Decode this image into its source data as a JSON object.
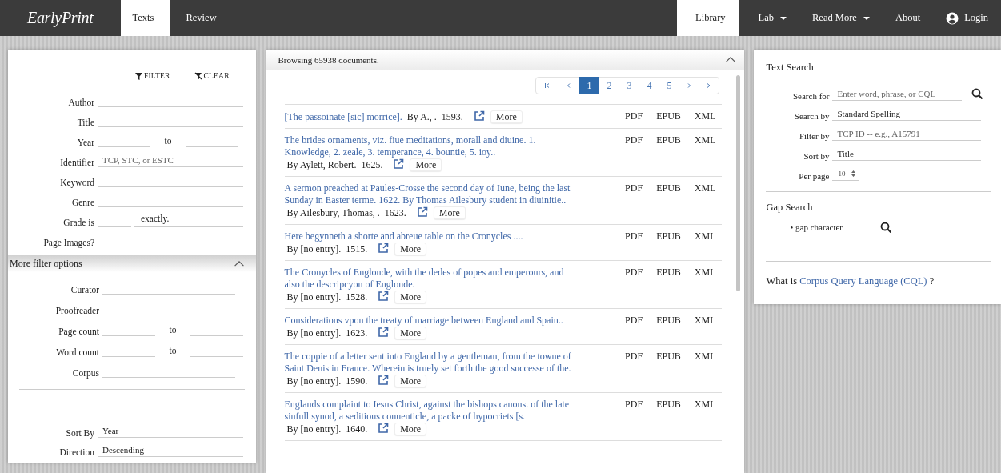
{
  "navbar": {
    "brand": "EarlyPrint",
    "left_tabs": [
      {
        "label": "Texts",
        "selected": true
      },
      {
        "label": "Review",
        "selected": false
      }
    ],
    "right_items": [
      {
        "label": "Library",
        "selected": true,
        "kind": "link"
      },
      {
        "label": "Lab",
        "selected": false,
        "kind": "dropdown"
      },
      {
        "label": "Read More",
        "selected": false,
        "kind": "dropdown"
      },
      {
        "label": "About",
        "selected": false,
        "kind": "link"
      },
      {
        "label": "Login",
        "selected": false,
        "kind": "user"
      }
    ]
  },
  "filter_panel": {
    "filter_button": "FILTER",
    "clear_button": "CLEAR",
    "fields": [
      {
        "label": "Author",
        "kind": "single"
      },
      {
        "label": "Title",
        "kind": "single"
      },
      {
        "label": "Year",
        "kind": "range",
        "between": "to"
      },
      {
        "label": "Identifier",
        "kind": "single",
        "placeholder": "TCP, STC, or ESTC"
      },
      {
        "label": "Keyword",
        "kind": "single"
      },
      {
        "label": "Genre",
        "kind": "single"
      },
      {
        "label": "Grade is",
        "kind": "grade",
        "suffix": "exactly."
      },
      {
        "label": "Page Images?",
        "kind": "short"
      }
    ],
    "more_options": {
      "title": "More filter options",
      "expanded": true,
      "fields": [
        {
          "label": "Curator",
          "kind": "single"
        },
        {
          "label": "Proofreader",
          "kind": "single"
        },
        {
          "label": "Page count",
          "kind": "range",
          "between": "to"
        },
        {
          "label": "Word count",
          "kind": "range",
          "between": "to"
        },
        {
          "label": "Corpus",
          "kind": "single"
        }
      ]
    },
    "sort_fields": [
      {
        "label": "Sort By",
        "value": "Year"
      },
      {
        "label": "Direction",
        "value": "Descending"
      }
    ]
  },
  "results": {
    "heading": "Browsing 65938 documents.",
    "expanded": true,
    "pages": [
      {
        "label": "1",
        "selected": true
      },
      {
        "label": "2",
        "selected": false
      },
      {
        "label": "3",
        "selected": false
      },
      {
        "label": "4",
        "selected": false
      },
      {
        "label": "5",
        "selected": false
      }
    ],
    "rows": [
      {
        "title": "[The passoinate [sic] morrice].",
        "byline": "By A., .",
        "year": "1593.",
        "more": "More",
        "formats": [
          "PDF",
          "EPUB",
          "XML"
        ]
      },
      {
        "title": "The brides ornaments, viz. fiue meditations, morall and diuine. 1. Knowledge, 2. zeale, 3. temperance, 4. bountie, 5. ioy..",
        "byline": "By Aylett, Robert.",
        "year": "1625.",
        "more": "More",
        "formats": [
          "PDF",
          "EPUB",
          "XML"
        ]
      },
      {
        "title": "A sermon preached at Paules-Crosse the second day of Iune, being the last Sunday in Easter terme. 1622. By Thomas Ailesbury student in diuinitie..",
        "byline": "By Ailesbury, Thomas, .",
        "year": "1623.",
        "more": "More",
        "formats": [
          "PDF",
          "EPUB",
          "XML"
        ]
      },
      {
        "title": "Here begynneth a shorte and abreue table on the Cronycles ....",
        "byline": "By [no entry].",
        "year": "1515.",
        "more": "More",
        "formats": [
          "PDF",
          "EPUB",
          "XML"
        ]
      },
      {
        "title": "The Cronycles of Englonde, with the dedes of popes and emperours, and also the descripcyon of Englonde.",
        "byline": "By [no entry].",
        "year": "1528.",
        "more": "More",
        "formats": [
          "PDF",
          "EPUB",
          "XML"
        ]
      },
      {
        "title": "Considerations vpon the treaty of marriage between England and Spain..",
        "byline": "By [no entry].",
        "year": "1623.",
        "more": "More",
        "formats": [
          "PDF",
          "EPUB",
          "XML"
        ]
      },
      {
        "title": "The coppie of a letter sent into England by a gentleman, from the towne of Saint Denis in France. Wherein is truely set forth the good successe of the.",
        "byline": "By [no entry].",
        "year": "1590.",
        "more": "More",
        "formats": [
          "PDF",
          "EPUB",
          "XML"
        ]
      },
      {
        "title": "Englands complaint to Iesus Christ, against the bishops canons. of the late sinfull synod, a seditious conuenticle, a packe of hypocriets [s.",
        "byline": "By [no entry].",
        "year": "1640.",
        "more": "More",
        "formats": [
          "PDF",
          "EPUB",
          "XML"
        ]
      }
    ]
  },
  "search_panel": {
    "text_search": {
      "heading": "Text Search",
      "fields": [
        {
          "label": "Search for",
          "kind": "search",
          "placeholder": "Enter word, phrase, or CQL"
        },
        {
          "label": "Search by",
          "kind": "select",
          "value": "Standard Spelling"
        },
        {
          "label": "Filter by",
          "kind": "text",
          "placeholder": "TCP ID -- e.g., A15791"
        },
        {
          "label": "Sort by",
          "kind": "select",
          "value": "Title"
        },
        {
          "label": "Per page",
          "kind": "number",
          "value": "10"
        }
      ]
    },
    "gap_search": {
      "heading": "Gap Search",
      "value": "• gap character"
    },
    "cql_help": {
      "before": "What is ",
      "link": "Corpus Query Language (CQL)",
      "after": " ?"
    }
  }
}
